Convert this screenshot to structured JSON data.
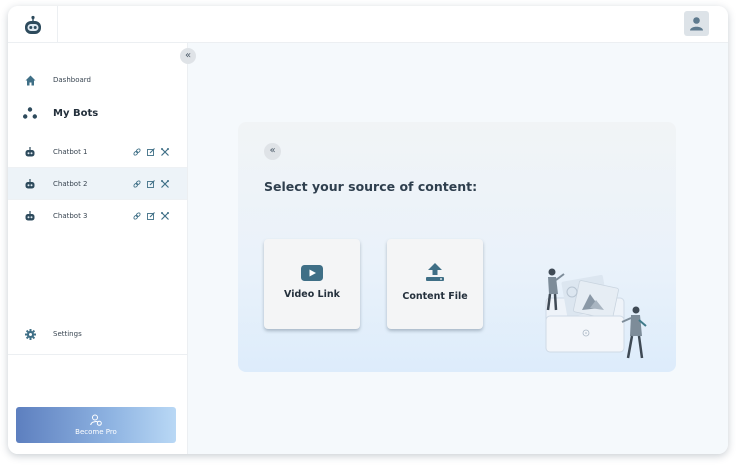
{
  "sidebar": {
    "dashboard_label": "Dashboard",
    "mybots_label": "My Bots",
    "bots": [
      {
        "label": "Chatbot 1",
        "active": false
      },
      {
        "label": "Chatbot 2",
        "active": true
      },
      {
        "label": "Chatbot 3",
        "active": false
      }
    ],
    "settings_label": "Settings",
    "pro_label": "Become Pro",
    "collapse_glyph": "«"
  },
  "main": {
    "back_glyph": "«",
    "heading": "Select your source of content:",
    "options": [
      {
        "label": "Video Link",
        "icon": "youtube-icon"
      },
      {
        "label": "Content File",
        "icon": "upload-icon"
      }
    ]
  },
  "colors": {
    "accent": "#3f6f86",
    "icon_dark": "#2d4a5c",
    "pro_gradient_start": "#5d7fbf",
    "pro_gradient_end": "#b9d8f5",
    "panel_bg": "#eaf2fa"
  }
}
